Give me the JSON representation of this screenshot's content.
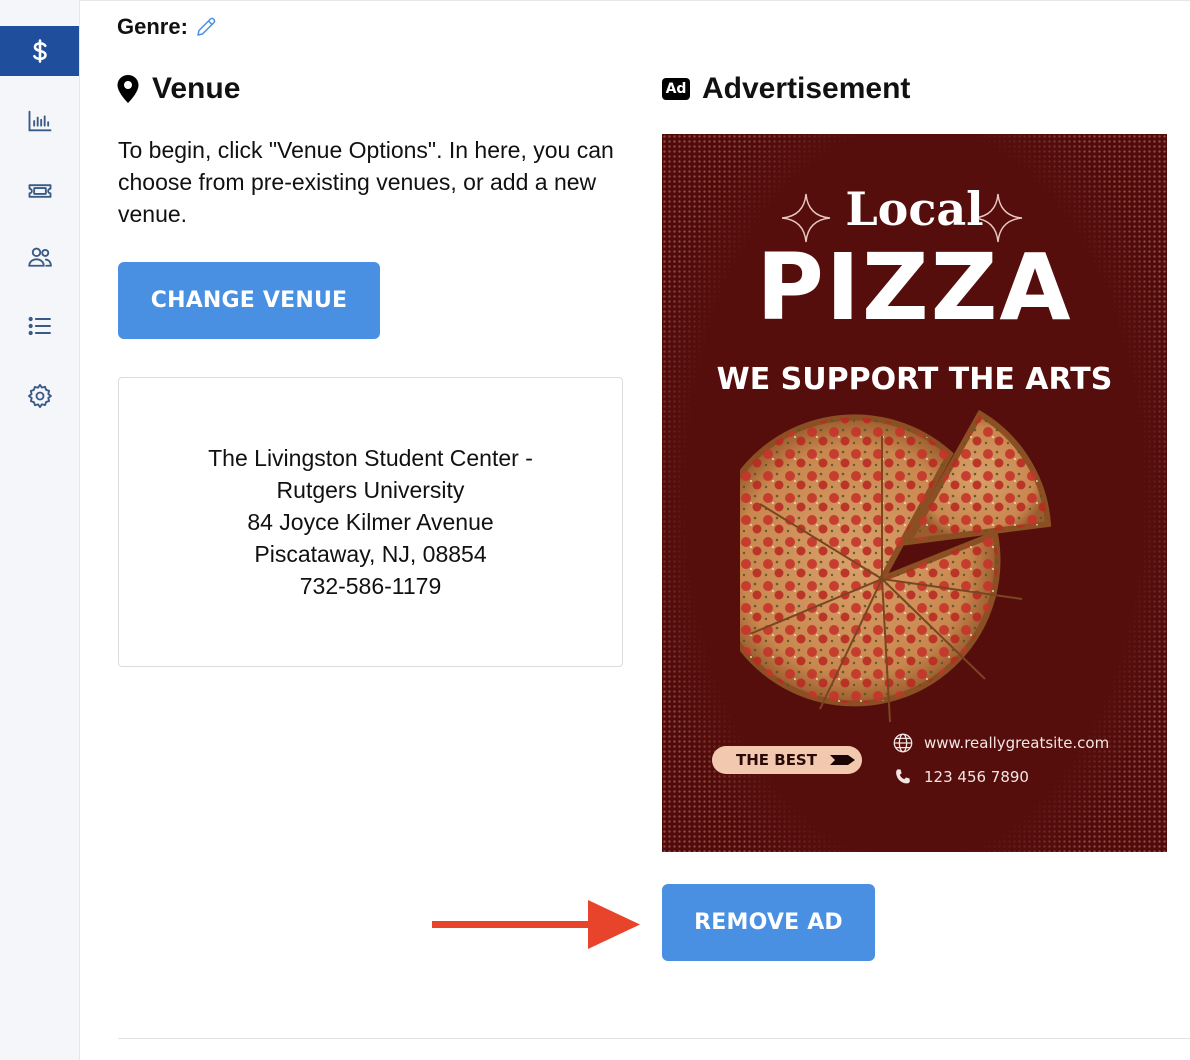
{
  "sidebar": {
    "items": [
      {
        "icon": "dollar-icon",
        "active": true
      },
      {
        "icon": "bar-chart-icon",
        "active": false
      },
      {
        "icon": "ticket-icon",
        "active": false
      },
      {
        "icon": "users-icon",
        "active": false
      },
      {
        "icon": "list-icon",
        "active": false
      },
      {
        "icon": "gear-icon",
        "active": false
      }
    ],
    "active_color": "#1f4e9c"
  },
  "genre": {
    "label": "Genre:"
  },
  "venue": {
    "heading": "Venue",
    "intro": "To begin, click \"Venue Options\". In here, you can choose from pre-existing venues, or add a new venue.",
    "change_button": "CHANGE VENUE",
    "card": {
      "name_line1": "The Livingston Student Center -",
      "name_line2": "Rutgers University",
      "street": "84 Joyce Kilmer Avenue",
      "city": "Piscataway, NJ, 08854",
      "phone": "732-586-1179"
    }
  },
  "advertisement": {
    "heading": "Advertisement",
    "badge_icon_text": "Ad",
    "ad": {
      "local": "Local",
      "pizza": "PIZZA",
      "tagline": "WE SUPPORT THE ARTS",
      "badge": "THE BEST",
      "website": "www.reallygreatsite.com",
      "phone": "123 456 7890"
    },
    "remove_button": "REMOVE AD"
  },
  "colors": {
    "button": "#4a90e2",
    "ad_background": "#560e0c",
    "arrow": "#e8442b"
  }
}
